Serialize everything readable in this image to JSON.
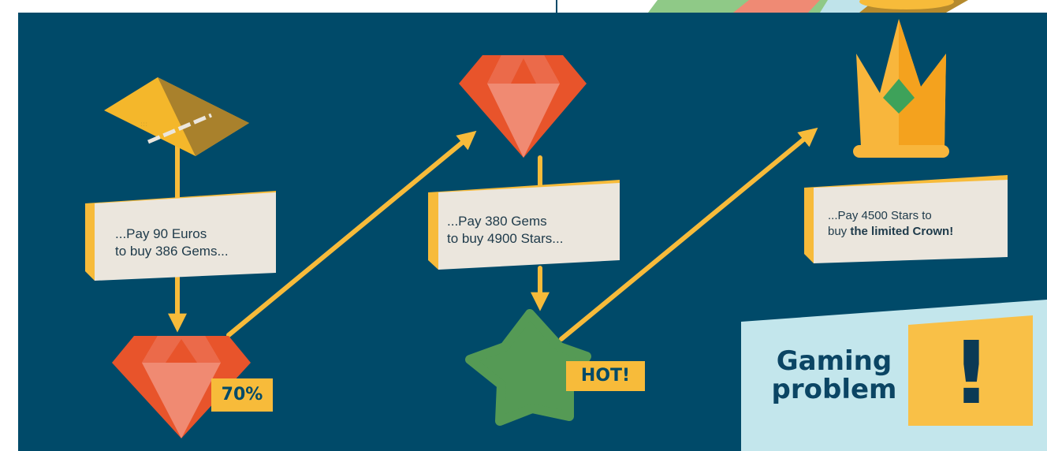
{
  "steps": [
    {
      "line1": "...Pay 90 Euros",
      "line2": "to buy 386 Gems..."
    },
    {
      "line1": "...Pay 380 Gems",
      "line2": "to buy 4900 Stars..."
    },
    {
      "line1": "...Pay 4500 Stars to",
      "line2_prefix": "buy ",
      "line2_bold": "the limited Crown!"
    }
  ],
  "badges": {
    "gem_discount": "70%",
    "star_hot": "HOT!"
  },
  "warning": {
    "line1": "Gaming",
    "line2": "problem",
    "mark": "!"
  },
  "icons": [
    "credit-card-icon",
    "gem-icon",
    "star-icon",
    "crown-icon",
    "banknote-icon",
    "coin-icon"
  ],
  "colors": {
    "background": "#004a69",
    "arrow": "#f7bb3a",
    "gem": "#e8542b",
    "star": "#559a55",
    "crown": "#f8b63c",
    "card_face": "#ebe6dd",
    "card_edge": "#f7bb3a",
    "warning_panel": "#c3e6ec"
  }
}
